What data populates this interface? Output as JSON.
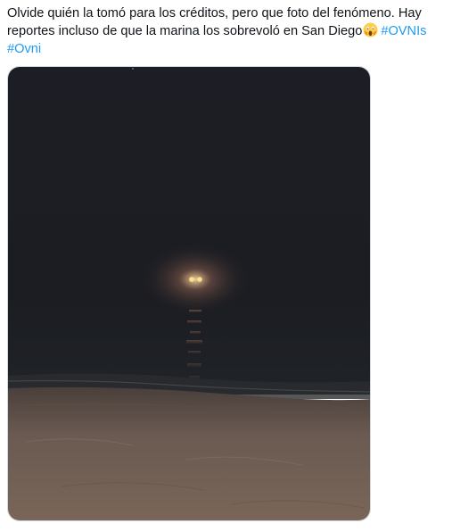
{
  "tweet": {
    "text_line1": "Olvide quién la tomó para los créditos, pero que foto del fenómeno. Hay",
    "text_line2": "reportes incluso de que la marina los sobrevoló en San Diego",
    "emoji": "scream-emoji",
    "hashtag_ovnis": "#OVNIs",
    "hashtag_ovni": "#Ovni",
    "hashtag_color": "#1d9bf0",
    "text_color": "#0f1419",
    "media": {
      "subject": "night beach photo with glowing lights over the sea",
      "sky_color": "#1c1d24",
      "sea_color": "#1a1d22",
      "sand_color": "#6e5c52",
      "light_color": "#ffd27a"
    }
  }
}
